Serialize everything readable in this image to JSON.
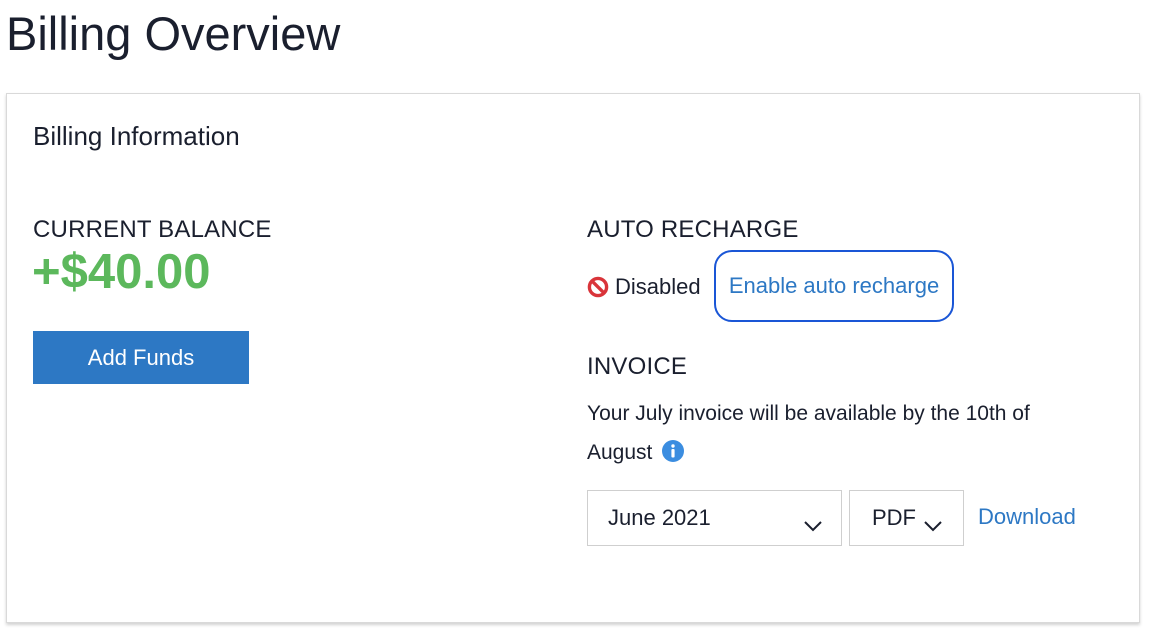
{
  "header": {
    "title": "Billing Overview"
  },
  "card": {
    "title": "Billing Information",
    "balance": {
      "heading": "CURRENT BALANCE",
      "amount": "+$40.00",
      "add_funds_label": "Add Funds"
    },
    "auto_recharge": {
      "heading": "AUTO RECHARGE",
      "status_icon": "disabled-icon",
      "status": "Disabled",
      "enable_label": "Enable auto recharge"
    },
    "invoice": {
      "heading": "INVOICE",
      "message_line1": "Your July invoice will be available by the 10th of",
      "message_line2": "August",
      "info_icon": "info-icon",
      "month_selected": "June 2021",
      "format_selected": "PDF",
      "download_label": "Download"
    }
  },
  "colors": {
    "balance_positive": "#5cb85c",
    "primary_button": "#2d78c4",
    "link": "#2d78c4",
    "focus_ring": "#1a56d6",
    "disabled_icon": "#d9343a",
    "info_icon": "#3b8de0"
  }
}
